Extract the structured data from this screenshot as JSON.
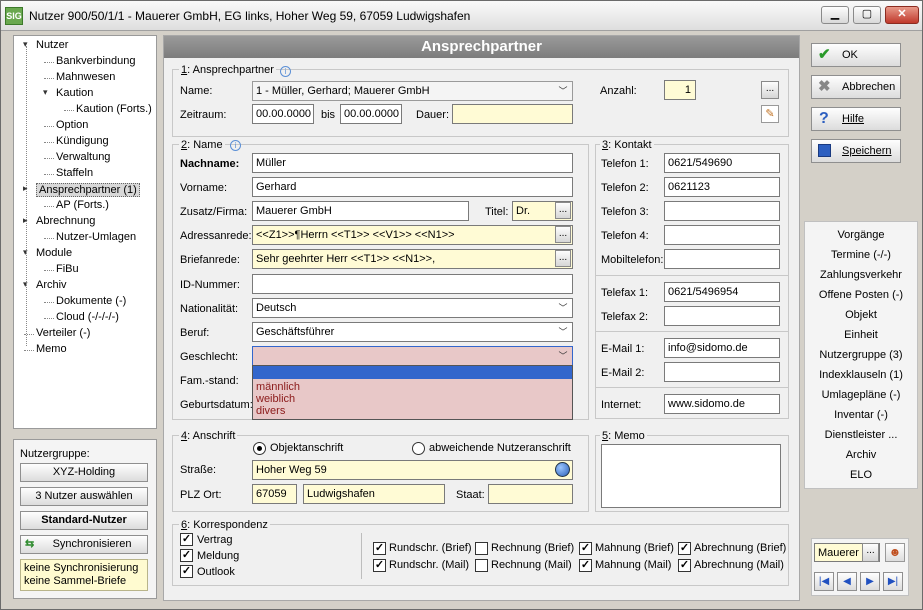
{
  "window": {
    "title": "Nutzer 900/50/1/1 - Mauerer GmbH, EG links, Hoher Weg 59, 67059 Ludwigshafen",
    "app_icon_text": "SIG"
  },
  "tree": [
    {
      "label": "Nutzer",
      "level": 0,
      "expander": "-"
    },
    {
      "label": "Bankverbindung",
      "level": 1
    },
    {
      "label": "Mahnwesen",
      "level": 1
    },
    {
      "label": "Kaution",
      "level": 1,
      "expander": "v"
    },
    {
      "label": "Kaution (Forts.)",
      "level": 2
    },
    {
      "label": "Option",
      "level": 1
    },
    {
      "label": "Kündigung",
      "level": 1
    },
    {
      "label": "Verwaltung",
      "level": 1
    },
    {
      "label": "Staffeln",
      "level": 1
    },
    {
      "label": "Ansprechpartner (1)",
      "level": 0,
      "expander": ">",
      "selected": true
    },
    {
      "label": "AP (Forts.)",
      "level": 1
    },
    {
      "label": "Abrechnung",
      "level": 0,
      "expander": ">"
    },
    {
      "label": "Nutzer-Umlagen",
      "level": 1
    },
    {
      "label": "Module",
      "level": 0,
      "expander": "-"
    },
    {
      "label": "FiBu",
      "level": 1
    },
    {
      "label": "Archiv",
      "level": 0,
      "expander": "-"
    },
    {
      "label": "Dokumente (-)",
      "level": 1
    },
    {
      "label": "Cloud (-/-/-/-)",
      "level": 1
    },
    {
      "label": "Verteiler (-)",
      "level": 0
    },
    {
      "label": "Memo",
      "level": 0
    }
  ],
  "nutzergruppe": {
    "label": "Nutzergruppe:",
    "btn_holding": "XYZ-Holding",
    "btn_select": "3 Nutzer auswählen",
    "btn_standard": "Standard-Nutzer",
    "btn_sync": "Synchronisieren",
    "note_line1": "keine Synchronisierung",
    "note_line2": "keine Sammel-Briefe"
  },
  "header": "Ansprechpartner",
  "section1": {
    "title_num": "1",
    "title": ": Ansprechpartner",
    "name_label": "Name:",
    "name_value": "1 - Müller, Gerhard; Mauerer GmbH",
    "zeitraum_label": "Zeitraum:",
    "zeitraum_from": "00.00.0000",
    "bis_label": "bis",
    "zeitraum_to": "00.00.0000",
    "dauer_label": "Dauer:",
    "dauer_value": "",
    "anzahl_label": "Anzahl:",
    "anzahl_value": "1",
    "more_btn": "..."
  },
  "section2": {
    "title_num": "2",
    "title": ": Name",
    "nachname_label": "Nachname:",
    "nachname_value": "Müller",
    "vorname_label": "Vorname:",
    "vorname_value": "Gerhard",
    "zusatz_label": "Zusatz/Firma:",
    "zusatz_value": "Mauerer GmbH",
    "titel_label": "Titel:",
    "titel_value": "Dr.",
    "adressanrede_label": "Adressanrede:",
    "adressanrede_value": "<<Z1>>¶Herrn <<T1>> <<V1>> <<N1>>",
    "briefanrede_label": "Briefanrede:",
    "briefanrede_value": "Sehr geehrter Herr <<T1>> <<N1>>,",
    "id_label": "ID-Nummer:",
    "id_value": "",
    "nationalitaet_label": "Nationalität:",
    "nationalitaet_value": "Deutsch",
    "beruf_label": "Beruf:",
    "beruf_value": "Geschäftsführer",
    "geschlecht_label": "Geschlecht:",
    "geschlecht_value": "",
    "geschlecht_options": [
      "",
      "männlich",
      "weiblich",
      "divers"
    ],
    "famstand_label": "Fam.-stand:",
    "geburtsdatum_label": "Geburtsdatum:"
  },
  "section3": {
    "title_num": "3",
    "title": ": Kontakt",
    "telefon1_label": "Telefon 1:",
    "telefon1_value": "0621/549690",
    "telefon2_label": "Telefon 2:",
    "telefon2_value": "0621123",
    "telefon3_label": "Telefon 3:",
    "telefon3_value": "",
    "telefon4_label": "Telefon 4:",
    "telefon4_value": "",
    "mobil_label": "Mobiltelefon:",
    "mobil_value": "",
    "fax1_label": "Telefax 1:",
    "fax1_value": "0621/5496954",
    "fax2_label": "Telefax 2:",
    "fax2_value": "",
    "email1_label": "E-Mail 1:",
    "email1_value": "info@sidomo.de",
    "email2_label": "E-Mail 2:",
    "email2_value": "",
    "internet_label": "Internet:",
    "internet_value": "www.sidomo.de"
  },
  "section4": {
    "title_num": "4",
    "title": ": Anschrift",
    "radio_objekt": "Objektanschrift",
    "radio_abweichend": "abweichende Nutzeranschrift",
    "strasse_label": "Straße:",
    "strasse_value": "Hoher Weg 59",
    "plz_label": "PLZ Ort:",
    "plz_value": "67059",
    "ort_value": "Ludwigshafen",
    "staat_label": "Staat:",
    "staat_value": ""
  },
  "section5": {
    "title_num": "5",
    "title": ": Memo",
    "memo_value": ""
  },
  "section6": {
    "title_num": "6",
    "title": ": Korrespondenz",
    "vertrag": "Vertrag",
    "meldung": "Meldung",
    "outlook": "Outlook",
    "rundschr_brief": "Rundschr. (Brief)",
    "rechnung_brief": "Rechnung (Brief)",
    "mahnung_brief": "Mahnung (Brief)",
    "abrechnung_brief": "Abrechnung (Brief)",
    "rundschr_mail": "Rundschr. (Mail)",
    "rechnung_mail": "Rechnung (Mail)",
    "mahnung_mail": "Mahnung (Mail)",
    "abrechnung_mail": "Abrechnung (Mail)"
  },
  "actions": {
    "ok": "OK",
    "abbrechen": "Abbrechen",
    "hilfe": "Hilfe",
    "speichern": "Speichern"
  },
  "right_list": [
    "Vorgänge",
    "Termine (-/-)",
    "Zahlungsverkehr",
    "Offene Posten (-)",
    "Objekt",
    "Einheit",
    "Nutzergruppe (3)",
    "Indexklauseln (1)",
    "Umlagepläne (-)",
    "Inventar (-)",
    "Dienstleister ...",
    "Archiv",
    "ELO"
  ],
  "nav": {
    "search_value": "Mauerer",
    "more_btn": "...",
    "first": "|◀",
    "prev": "◀",
    "next": "▶",
    "last": "▶|"
  },
  "colors": {
    "header_bg": "#8a8a8a",
    "field_yellow": "#fffbd5",
    "dropdown_highlight": "#3366cc",
    "dropdown_list_bg": "#e8c8c8",
    "dropdown_text": "#8b1a1a"
  }
}
